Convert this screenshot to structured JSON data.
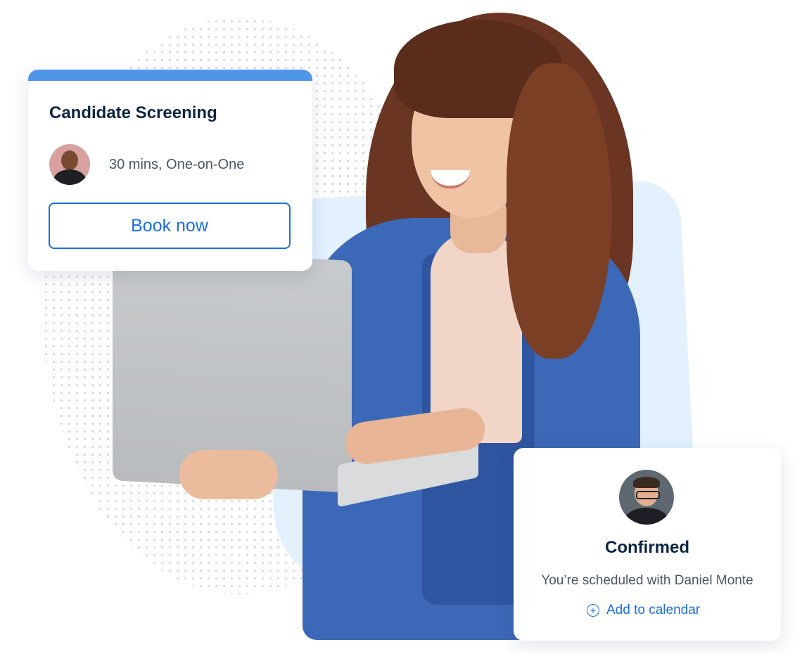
{
  "booking_card": {
    "title": "Candidate Screening",
    "meta": "30 mins, One-on-One",
    "button_label": "Book now",
    "accent_color": "#4f96e8"
  },
  "confirm_card": {
    "status": "Confirmed",
    "message": "You’re scheduled with Daniel Monte",
    "add_calendar_label": "Add to calendar",
    "icon": "plus-circle-icon",
    "link_color": "#1a6ee6"
  }
}
